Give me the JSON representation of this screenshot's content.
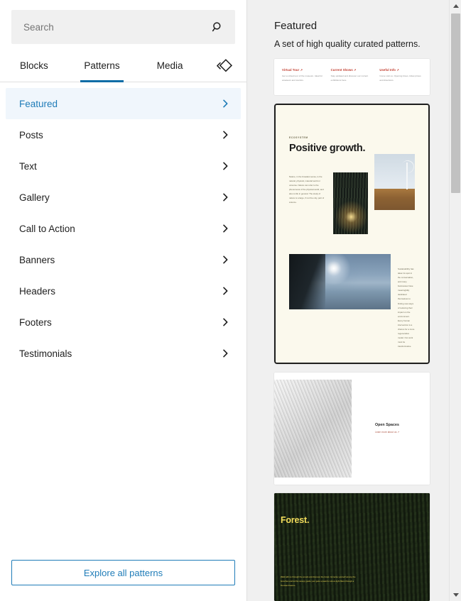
{
  "search": {
    "placeholder": "Search",
    "value": "",
    "icon": "search-icon"
  },
  "tabs": [
    {
      "label": "Blocks",
      "active": false
    },
    {
      "label": "Patterns",
      "active": true
    },
    {
      "label": "Media",
      "active": false
    }
  ],
  "tab_bar_icon": "block-diamond-icon",
  "categories": [
    {
      "label": "Featured",
      "selected": true
    },
    {
      "label": "Posts",
      "selected": false
    },
    {
      "label": "Text",
      "selected": false
    },
    {
      "label": "Gallery",
      "selected": false
    },
    {
      "label": "Call to Action",
      "selected": false
    },
    {
      "label": "Banners",
      "selected": false
    },
    {
      "label": "Headers",
      "selected": false
    },
    {
      "label": "Footers",
      "selected": false
    },
    {
      "label": "Testimonials",
      "selected": false
    }
  ],
  "footer": {
    "explore_label": "Explore all patterns"
  },
  "panel": {
    "title": "Featured",
    "description": "A set of high quality curated patterns."
  },
  "patterns": {
    "three_columns": {
      "columns": [
        {
          "heading": "Virtual Tour ↗",
          "body": "Get a virtual tour of the museum. Ideal for amateurs and tourists."
        },
        {
          "heading": "Current Shows ↗",
          "body": "Stay updated and discover our current exhibitions here."
        },
        {
          "heading": "Useful Info ↗",
          "body": "Come visit us. Opening times, ticket prices and directions."
        }
      ]
    },
    "positive_growth": {
      "eyebrow": "ECOSYSTEM",
      "title": "Positive growth.",
      "body_left": "Nature, in the broadest sense, is the natural, physical, material world or universe. Nature can refer to the phenomena of the physical world, and also to life in general. The study of nature is a large, if not the only, part of science.",
      "body_right": "Sustainability has taken its spot in the conversation, and many businesses have meaningfully dedicated themselves to finding new ways of reducing their impact on the environment. Every human intervention is a chance for a more regenerative model. Our work must be transformative."
    },
    "open_spaces": {
      "title": "Open Spaces",
      "link": "Learn more about us ↗"
    },
    "forest": {
      "title": "Forest.",
      "body": "Walk with us through the woods and discover the forest. Immerse yourself among the branches and let the canopy guide your gaze upward to where light filters through a thousand leaves."
    }
  },
  "scrollbar": {
    "up_arrow": "scroll-up-arrow-icon",
    "down_arrow": "scroll-down-arrow-icon"
  },
  "colors": {
    "accent": "#1f7cb8",
    "tab_underline": "#0b6ca6",
    "selected_bg": "#f0f6fc",
    "panel_bg": "#f0f0f0"
  }
}
